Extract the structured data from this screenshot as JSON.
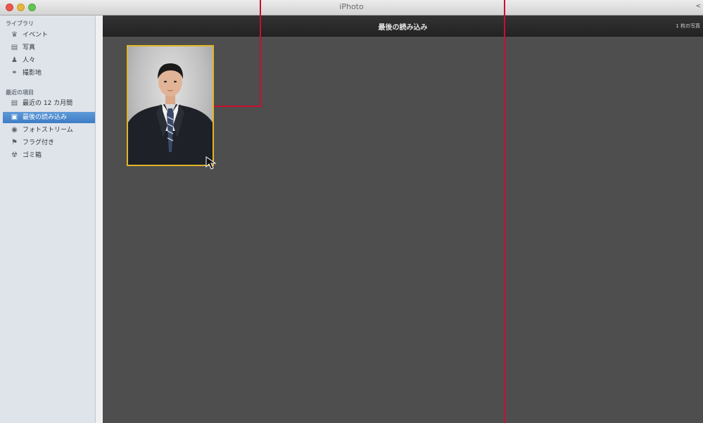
{
  "window": {
    "title": "iPhoto",
    "corner_glyph": "<"
  },
  "sidebar": {
    "sections": [
      {
        "header": "ライブラリ",
        "items": [
          {
            "label": "イベント",
            "icon": "event-icon"
          },
          {
            "label": "写真",
            "icon": "photos-icon"
          },
          {
            "label": "人々",
            "icon": "people-icon"
          },
          {
            "label": "撮影地",
            "icon": "places-icon"
          }
        ]
      },
      {
        "header": "最近の項目",
        "items": [
          {
            "label": "最近の 12 カ月間",
            "icon": "calendar-icon"
          },
          {
            "label": "最後の読み込み",
            "icon": "last-import-icon",
            "selected": true
          },
          {
            "label": "フォトストリーム",
            "icon": "photostream-icon"
          },
          {
            "label": "フラグ付き",
            "icon": "flag-icon"
          },
          {
            "label": "ゴミ箱",
            "icon": "trash-icon"
          }
        ]
      }
    ]
  },
  "content": {
    "title": "最後の読み込み",
    "count": "1 枚の写真"
  },
  "colors": {
    "selection": "#3d7cc6",
    "photo_border": "#e2b528",
    "annotation_line": "#c8102e",
    "content_bg": "#4e4e4e"
  }
}
